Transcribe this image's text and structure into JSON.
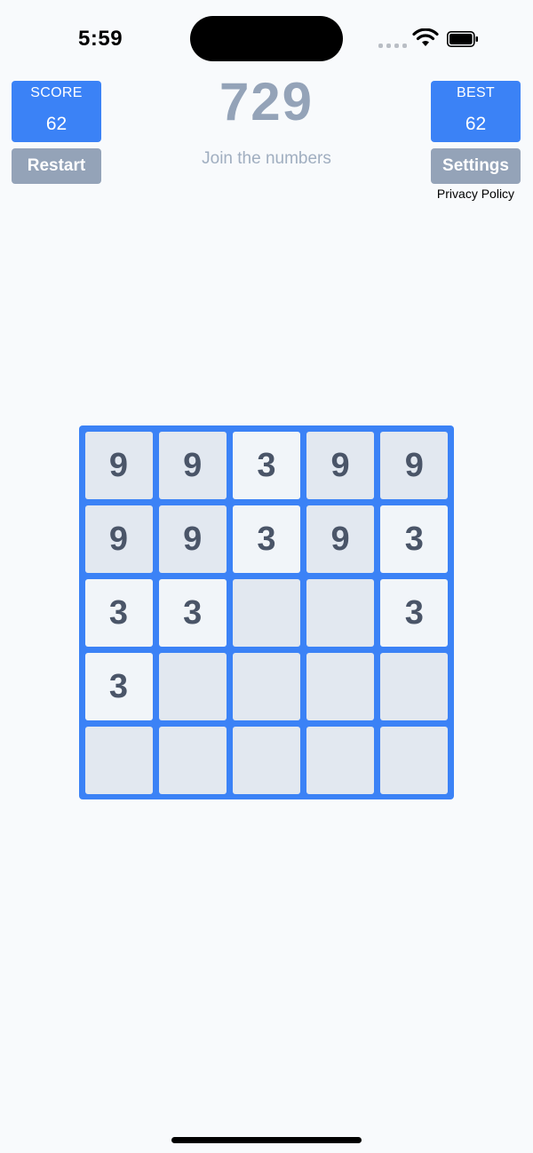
{
  "status_bar": {
    "time": "5:59"
  },
  "header": {
    "title": "729",
    "subtitle": "Join the numbers",
    "score_label": "SCORE",
    "score_value": "62",
    "best_label": "BEST",
    "best_value": "62",
    "restart_label": "Restart",
    "settings_label": "Settings",
    "privacy_label": "Privacy Policy"
  },
  "board": {
    "rows": [
      [
        "9",
        "9",
        "3",
        "9",
        "9"
      ],
      [
        "9",
        "9",
        "3",
        "9",
        "3"
      ],
      [
        "3",
        "3",
        "",
        "",
        "3"
      ],
      [
        "3",
        "",
        "",
        "",
        ""
      ],
      [
        "",
        "",
        "",
        "",
        ""
      ]
    ]
  },
  "colors": {
    "accent": "#3b82f6",
    "button_gray": "#94a3b8",
    "tile_3": "#f1f5f9",
    "tile_9": "#e2e8f0",
    "tile_empty": "#e2e8f0",
    "tile_text": "#4a5568",
    "background": "#f8fafc"
  }
}
